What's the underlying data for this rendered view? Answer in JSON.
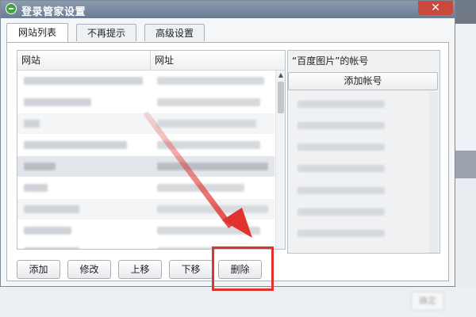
{
  "window": {
    "title": "登录管家设置",
    "close_label": "✕"
  },
  "tabs": [
    {
      "label": "网站列表",
      "active": true
    },
    {
      "label": "不再提示",
      "active": false
    },
    {
      "label": "高级设置",
      "active": false
    }
  ],
  "site_list": {
    "columns": [
      "网站",
      "网址"
    ],
    "rows": [
      {
        "site": "",
        "url": ""
      },
      {
        "site": "",
        "url": ""
      },
      {
        "site": "",
        "url": ""
      },
      {
        "site": "",
        "url": ""
      },
      {
        "site": "",
        "url": ""
      },
      {
        "site": "",
        "url": ""
      },
      {
        "site": "",
        "url": ""
      },
      {
        "site": "",
        "url": ""
      },
      {
        "site": "",
        "url": ""
      }
    ]
  },
  "account_panel": {
    "title": "“百度图片”的帐号",
    "add_label": "添加帐号",
    "accounts": [
      "",
      "",
      "",
      "",
      "",
      "",
      ""
    ]
  },
  "buttons": {
    "add": "添加",
    "edit": "修改",
    "move_up": "上移",
    "move_down": "下移",
    "delete": "删除"
  },
  "background": {
    "button_label": "确定"
  },
  "colors": {
    "annotation_red": "#e0332e",
    "title_bar": "#7d8fa6",
    "close_button": "#c94a3c"
  }
}
